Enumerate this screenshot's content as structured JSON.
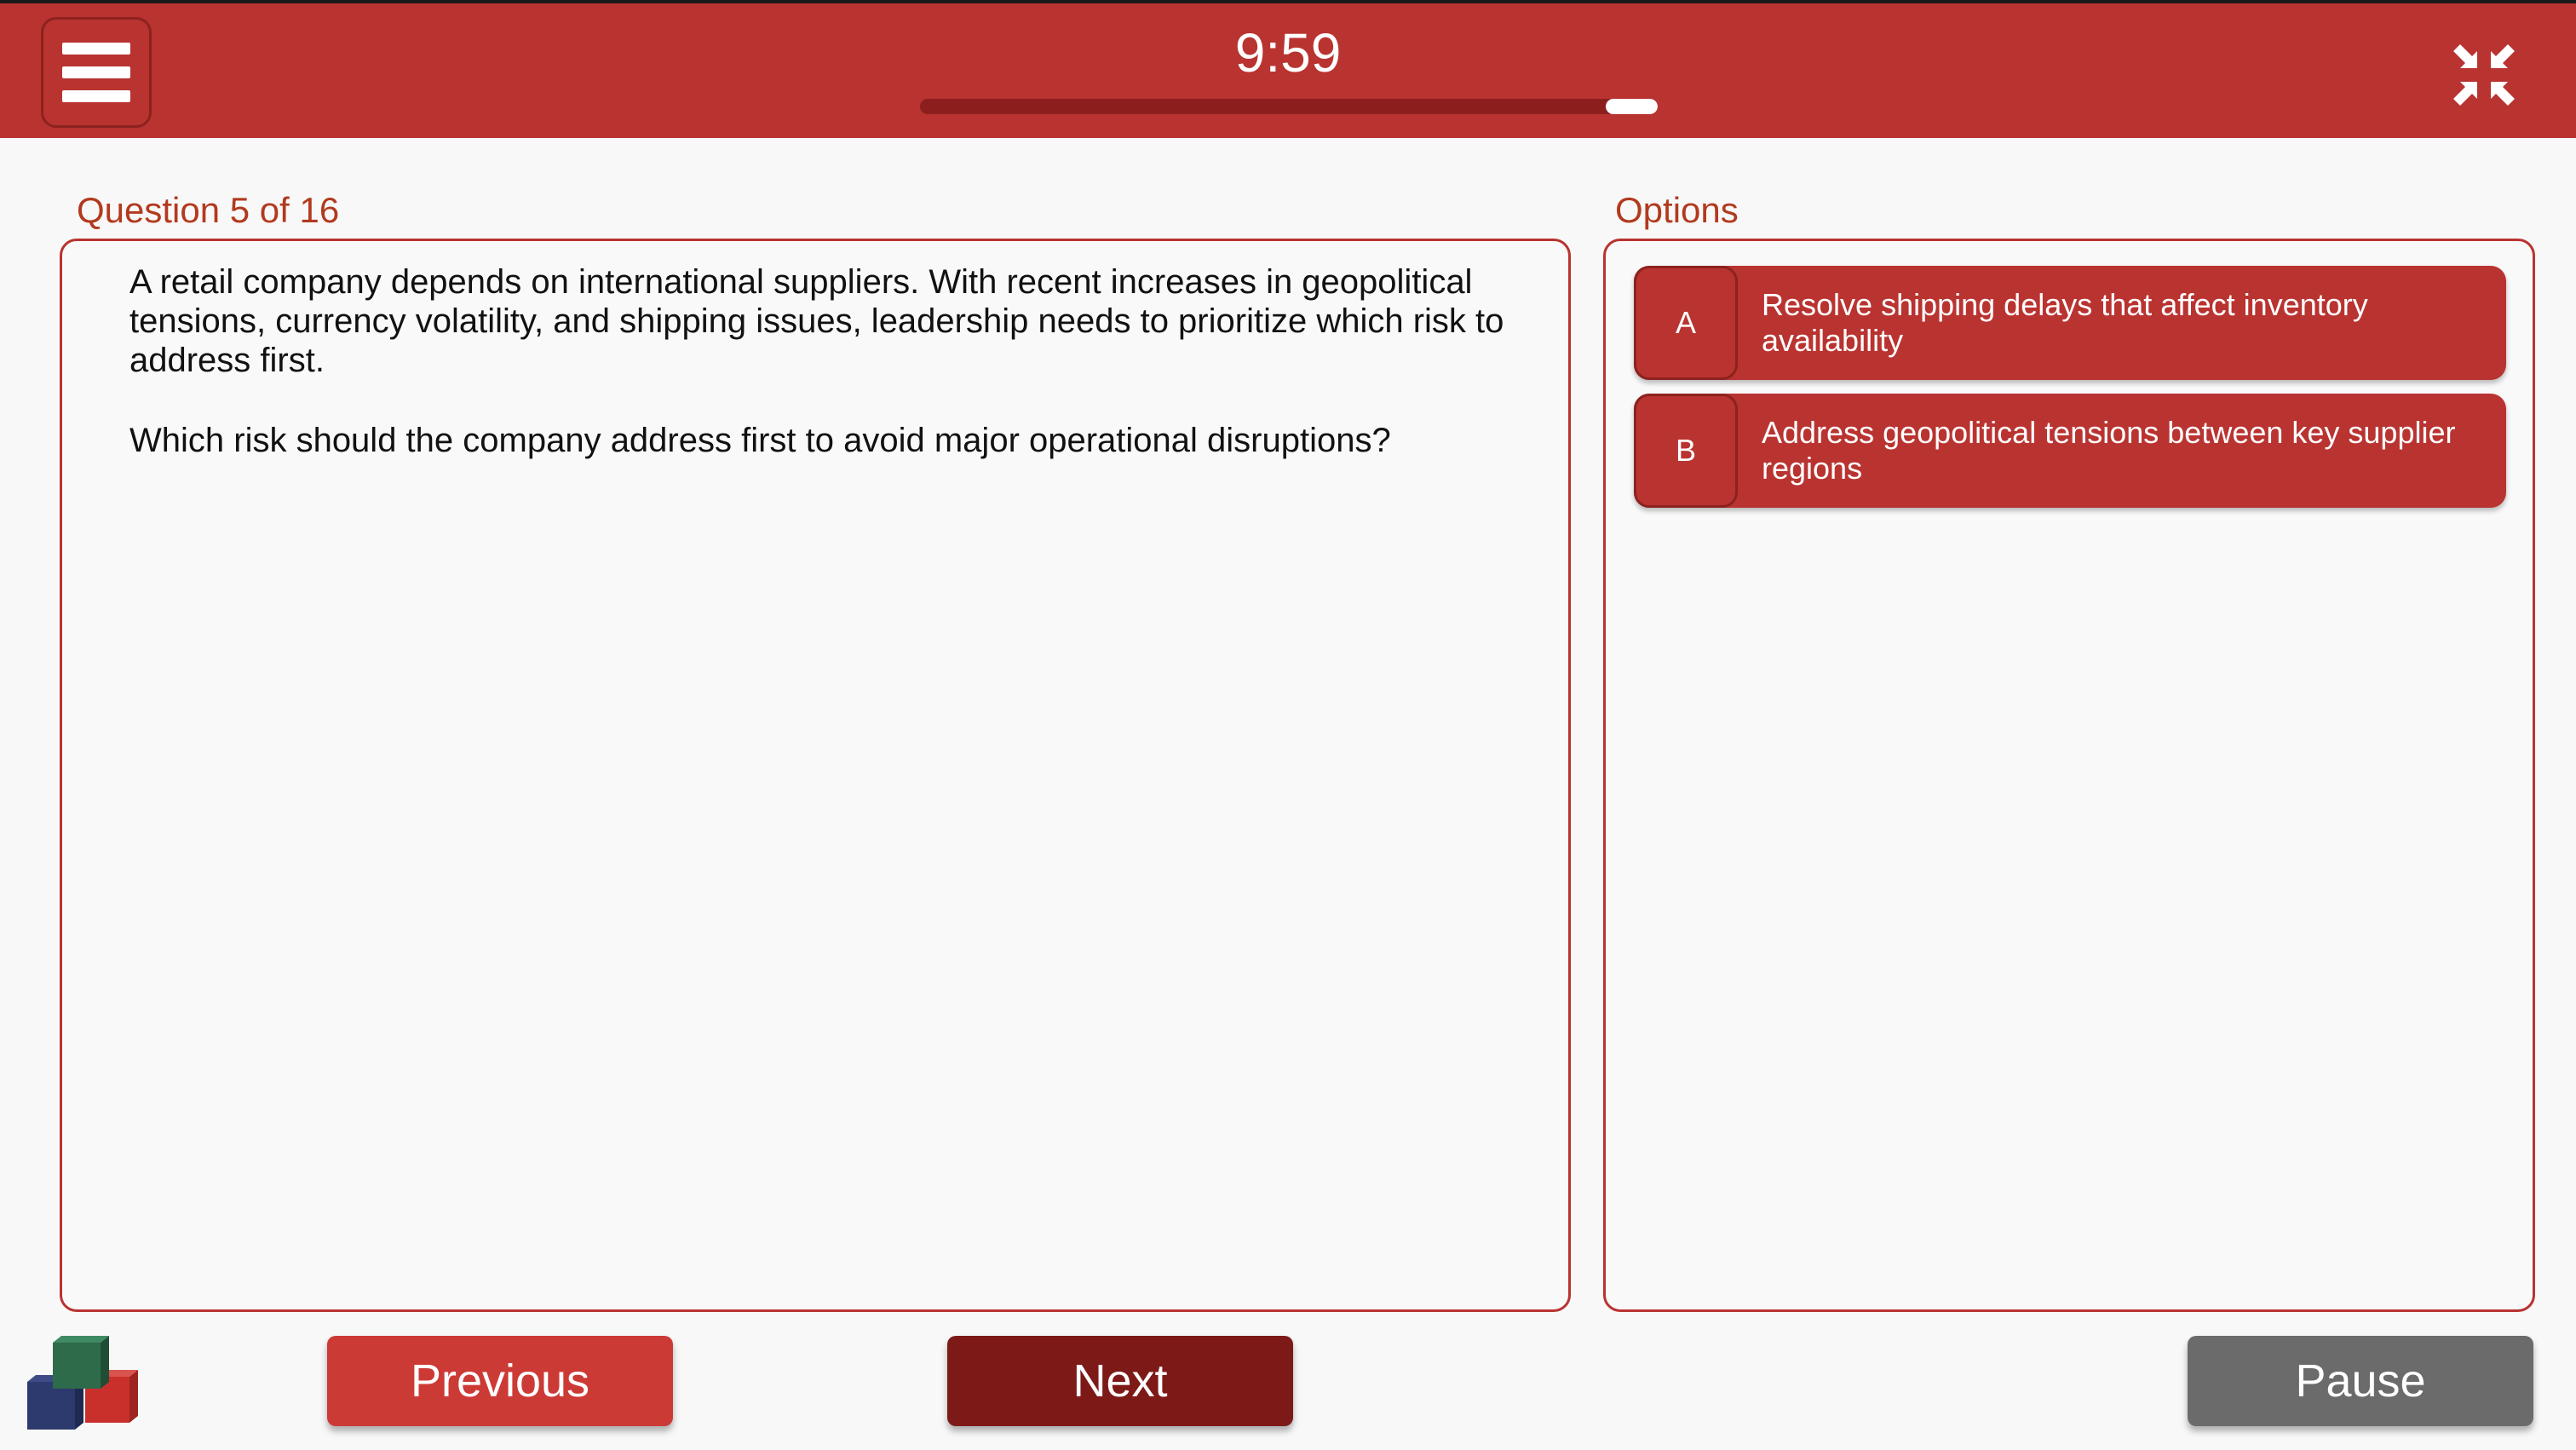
{
  "header": {
    "menu_icon": "hamburger-menu-icon",
    "timer": "9:59",
    "progress_remaining_fraction": 0.07,
    "collapse_icon": "collapse-fullscreen-icon",
    "accent_color": "#b93330"
  },
  "question": {
    "counter": "Question 5 of 16",
    "paragraphs": [
      "A retail company depends on international suppliers. With recent increases in geopolitical tensions, currency volatility, and shipping issues, leadership needs to prioritize which risk to address first.",
      "Which risk should the company address first to avoid major operational disruptions?"
    ]
  },
  "options": {
    "label": "Options",
    "items": [
      {
        "letter": "A",
        "text": "Resolve shipping delays that affect inventory availability"
      },
      {
        "letter": "B",
        "text": "Address geopolitical tensions between key supplier regions"
      }
    ]
  },
  "footer": {
    "logo": "stacked-cubes-logo",
    "previous_label": "Previous",
    "next_label": "Next",
    "pause_label": "Pause"
  }
}
